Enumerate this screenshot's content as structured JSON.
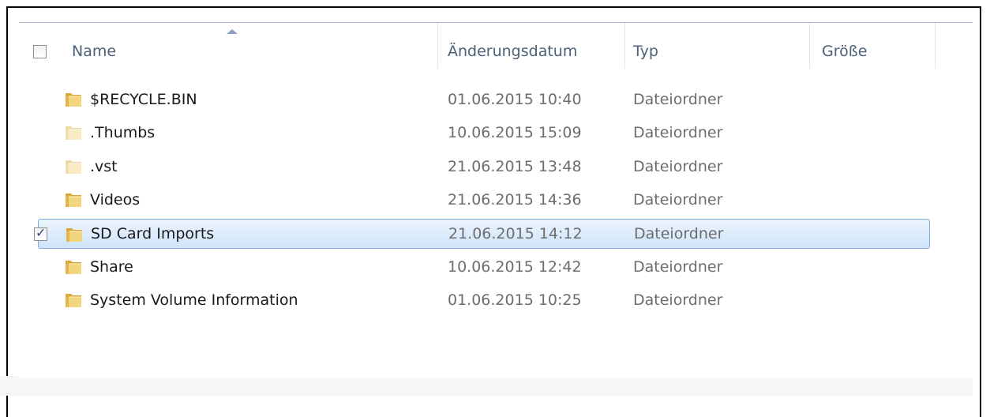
{
  "header": {
    "select_all_checked": false,
    "columns": {
      "name": "Name",
      "date": "Änderungsdatum",
      "type": "Typ",
      "size": "Größe"
    },
    "sort_column": "name",
    "sort_direction": "ascending"
  },
  "rows": [
    {
      "name": "$RECYCLE.BIN",
      "date": "01.06.2015 10:40",
      "type": "Dateiordner",
      "size": "",
      "hidden": false,
      "selected": false
    },
    {
      "name": ".Thumbs",
      "date": "10.06.2015 15:09",
      "type": "Dateiordner",
      "size": "",
      "hidden": true,
      "selected": false
    },
    {
      "name": ".vst",
      "date": "21.06.2015 13:48",
      "type": "Dateiordner",
      "size": "",
      "hidden": true,
      "selected": false
    },
    {
      "name": "Videos",
      "date": "21.06.2015 14:36",
      "type": "Dateiordner",
      "size": "",
      "hidden": false,
      "selected": false
    },
    {
      "name": "SD Card Imports",
      "date": "21.06.2015 14:12",
      "type": "Dateiordner",
      "size": "",
      "hidden": false,
      "selected": true
    },
    {
      "name": "Share",
      "date": "10.06.2015 12:42",
      "type": "Dateiordner",
      "size": "",
      "hidden": false,
      "selected": false
    },
    {
      "name": "System Volume Information",
      "date": "01.06.2015 10:25",
      "type": "Dateiordner",
      "size": "",
      "hidden": false,
      "selected": false
    }
  ],
  "icons": {
    "folder": "folder-icon",
    "sort": "sort-ascending-icon",
    "checkbox": "checkbox-icon"
  },
  "colors": {
    "selection_border": "#84acdd",
    "selection_fill_top": "#ebf4fd",
    "selection_fill_bottom": "#cfe4fa",
    "header_text": "#4c607a",
    "secondary_text": "#6d6d6d",
    "folder_yellow": "#e8c15a"
  }
}
